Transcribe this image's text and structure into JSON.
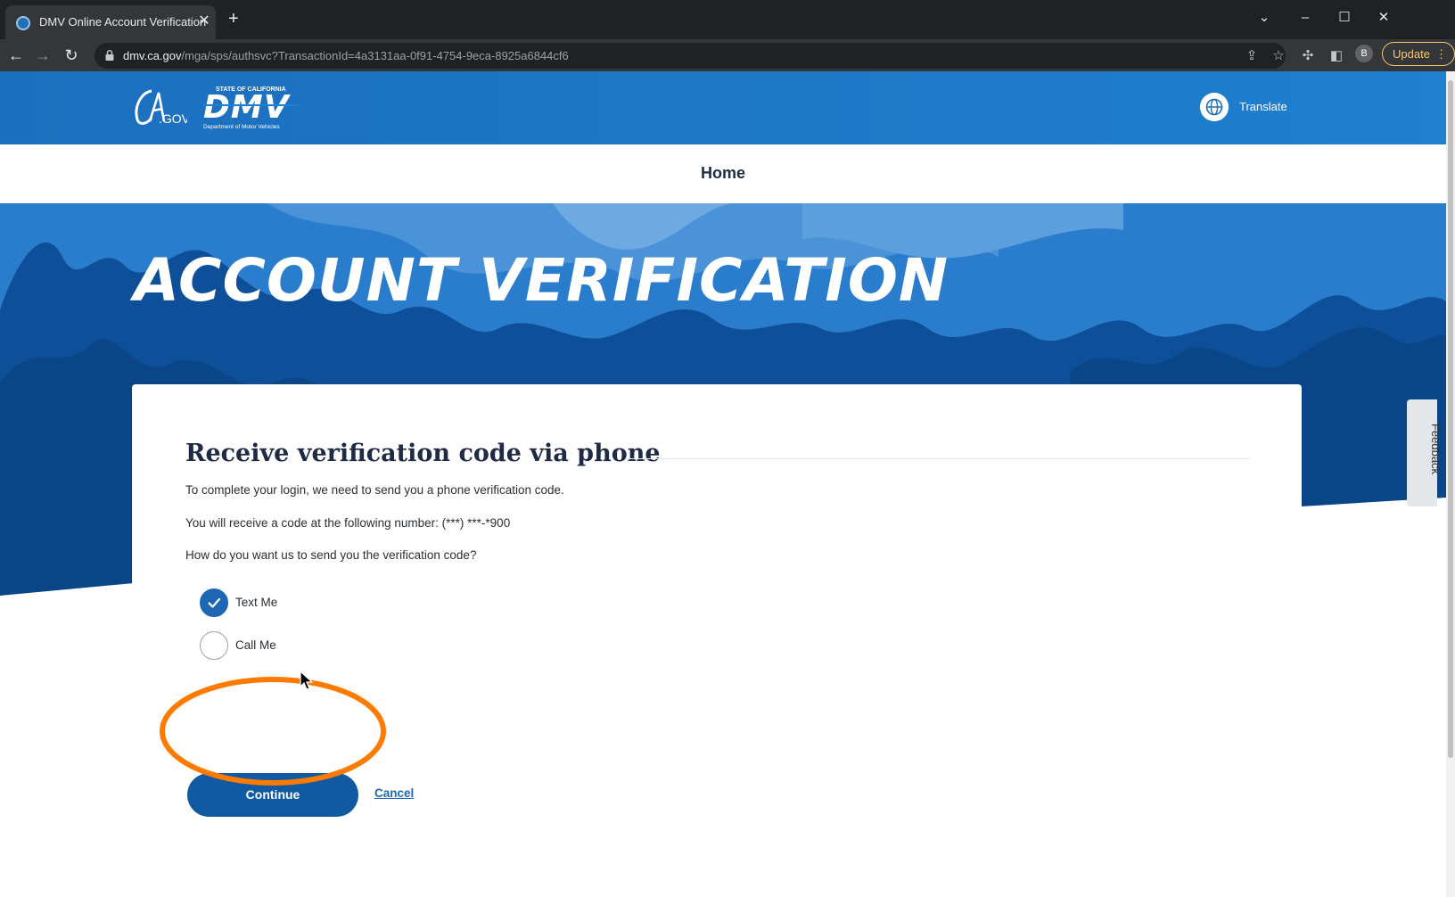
{
  "browser": {
    "tab_title": "DMV Online Account Verification",
    "url_host": "dmv.ca.gov",
    "url_path": "/mga/sps/authsvc?TransactionId=4a3131aa-0f91-4754-9eca-8925a6844cf6",
    "profile_initial": "B",
    "update_label": "Update"
  },
  "header": {
    "ca_logo": "CA.GOV",
    "dmv_logo_top": "STATE OF CALIFORNIA",
    "dmv_logo_main": "DMV",
    "dmv_logo_sub": "Department of Motor Vehicles",
    "translate_label": "Translate"
  },
  "nav": {
    "home_label": "Home"
  },
  "hero": {
    "title": "ACCOUNT VERIFICATION"
  },
  "card": {
    "heading": "Receive verification code via phone",
    "intro": "To complete your login, we need to send you a phone verification code.",
    "number_text": "You will receive a code at the following number: (***) ***-*900",
    "question": "How do you want us to send you the verification code?",
    "options": [
      {
        "label": "Text Me",
        "checked": true
      },
      {
        "label": "Call Me",
        "checked": false
      }
    ],
    "continue_label": "Continue",
    "cancel_label": "Cancel"
  },
  "feedback_label": "Feedback",
  "colors": {
    "header_blue": "#1f7fd0",
    "hero_dark": "#0d4f99",
    "button_blue": "#0f5aa0",
    "annotation_orange": "#ff7a00"
  },
  "icons": [
    "globe-icon",
    "lock-icon",
    "checkmark-icon",
    "cursor-icon"
  ]
}
